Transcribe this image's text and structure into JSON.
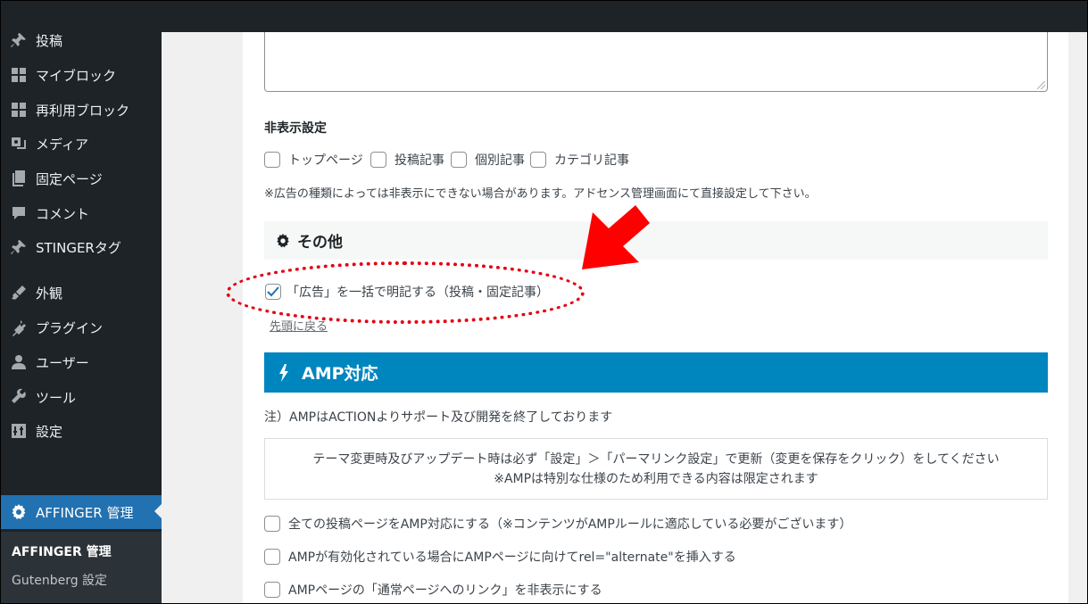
{
  "sidebar": {
    "items": [
      {
        "label": "投稿",
        "icon": "pin-icon"
      },
      {
        "label": "マイブロック",
        "icon": "blocks-icon"
      },
      {
        "label": "再利用ブロック",
        "icon": "blocks-icon"
      },
      {
        "label": "メディア",
        "icon": "media-icon"
      },
      {
        "label": "固定ページ",
        "icon": "pages-icon"
      },
      {
        "label": "コメント",
        "icon": "comment-icon"
      },
      {
        "label": "STINGERタグ",
        "icon": "pin-icon"
      },
      {
        "label": "外観",
        "icon": "appearance-icon"
      },
      {
        "label": "プラグイン",
        "icon": "plugin-icon"
      },
      {
        "label": "ユーザー",
        "icon": "user-icon"
      },
      {
        "label": "ツール",
        "icon": "wrench-icon"
      },
      {
        "label": "設定",
        "icon": "settings-icon"
      }
    ],
    "active_item": {
      "label": "AFFINGER 管理",
      "icon": "gear-icon"
    },
    "submenu": [
      {
        "label": "AFFINGER 管理",
        "current": true
      },
      {
        "label": "Gutenberg 設定",
        "current": false
      }
    ]
  },
  "hide_settings": {
    "title": "非表示設定",
    "options": [
      {
        "label": "トップページ",
        "checked": false
      },
      {
        "label": "投稿記事",
        "checked": false
      },
      {
        "label": "個別記事",
        "checked": false
      },
      {
        "label": "カテゴリ記事",
        "checked": false
      }
    ],
    "note": "※広告の種類によっては非表示にできない場合があります。アドセンス管理画面にて直接設定して下さい。"
  },
  "other_section": {
    "title": "その他",
    "option": {
      "label": "「広告」を一括で明記する（投稿・固定記事）",
      "checked": true
    },
    "back_link": "先頭に戻る"
  },
  "amp_section": {
    "title": "AMP対応",
    "notice": "注）AMPはACTIONよりサポート及び開発を終了しております",
    "info_line1": "テーマ変更時及びアップデート時は必ず「設定」＞「パーマリンク設定」で更新（変更を保存をクリック）をしてください",
    "info_line2": "※AMPは特別な仕様のため利用できる内容は限定されます",
    "options": [
      {
        "label": "全ての投稿ページをAMP対応にする（※コンテンツがAMPルールに適応している必要がございます）",
        "checked": false
      },
      {
        "label": "AMPが有効化されている場合にAMPページに向けてrel=\"alternate\"を挿入する",
        "checked": false
      },
      {
        "label": "AMPページの「通常ページへのリンク」を非表示にする",
        "checked": false
      }
    ]
  },
  "colors": {
    "sidebar_bg": "#1d2327",
    "active_menu": "#2271b1",
    "amp_bar": "#0086bf",
    "highlight_red": "#e50012",
    "checkmark": "#2271b1"
  }
}
